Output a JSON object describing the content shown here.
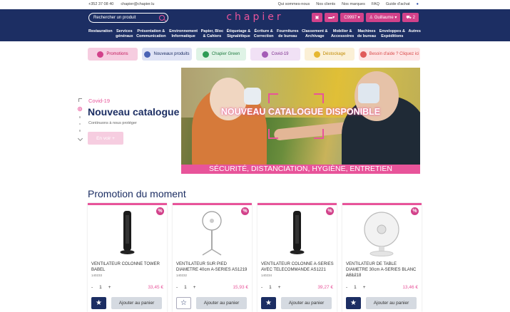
{
  "topbar": {
    "phone": "+352 37 08 40",
    "email": "chapier@chapier.lu",
    "links": [
      "Qui sommes-nous",
      "Nos clients",
      "Nos marques",
      "FAQ",
      "Guide d'achat"
    ]
  },
  "header": {
    "search_placeholder": "Rechercher un produit",
    "logo": "chapier",
    "account_code": "C9997",
    "user": "Guillaume",
    "cart_count": "2"
  },
  "nav": [
    "Restauration",
    "Services\ngénéraux",
    "Présentation &\nCommunication",
    "Environnement\nInformatique",
    "Papier, Bloc\n& Cahiers",
    "Étiquetage &\nSignalétique",
    "Écriture &\nCorrection",
    "Fournitures\nde bureau",
    "Classement &\nArchivage",
    "Mobilier &\nAccessoires",
    "Machines\nde bureau",
    "Enveloppes &\nExpéditions",
    "Autres"
  ],
  "categories": [
    {
      "label": "Promotions",
      "bg": "#f6cde0",
      "color": "#c2185b",
      "icon": "#d2418a"
    },
    {
      "label": "Nouveaux produits",
      "bg": "#dfe3f5",
      "color": "#1c2e63",
      "icon": "#4a63b5"
    },
    {
      "label": "Chapier Green",
      "bg": "#dff3e6",
      "color": "#1c7a3e",
      "icon": "#2e9c55"
    },
    {
      "label": "Covid-19",
      "bg": "#f1e1f5",
      "color": "#7b2c8c",
      "icon": "#a45bb6"
    },
    {
      "label": "Déstockage",
      "bg": "#fbf0d6",
      "color": "#c08a00",
      "icon": "#e6b730"
    },
    {
      "label": "Besoin d'aide ? Cliquez ici",
      "bg": "#fde4e4",
      "color": "#d94a4a",
      "icon": "#e05a5a"
    }
  ],
  "hero": {
    "kicker": "Covid-19",
    "title": "Nouveau catalogue",
    "subtitle": "Continuons à nous protéger",
    "button": "En voir +",
    "banner_title": "NOUVEAU CATALOGUE DISPONIBLE",
    "banner_bottom": "SÉCURITÉ, DISTANCIATION, HYGIÈNE, ENTRETIEN"
  },
  "section_title": "Promotion du moment",
  "products": [
    {
      "name": "VENTILATEUR COLONNE TOWER BABEL",
      "ref": "140233",
      "qty": "1",
      "price": "33,45 €",
      "image": "tower-fan-icon",
      "favorite": true
    },
    {
      "name": "VENTILATEUR SUR PIED DIAMETRE 40cm A-SERIES AS1219",
      "ref": "140232",
      "qty": "1",
      "price": "15,93 €",
      "image": "standing-fan-icon",
      "favorite": false
    },
    {
      "name": "VENTILATEUR COLONNE A-SERIES AVEC TELECOMMANDE AS1221",
      "ref": "140234",
      "qty": "1",
      "price": "39,27 €",
      "image": "tower-fan-icon",
      "favorite": true
    },
    {
      "name": "VENTILATEUR DE TABLE DIAMETRE 30cm A-SERIES BLANC AS1218",
      "ref": "140231",
      "qty": "1",
      "price": "13,46 €",
      "image": "desk-fan-icon",
      "favorite": true
    }
  ],
  "labels": {
    "add_to_cart": "Ajouter au panier",
    "minus": "-",
    "plus": "+",
    "badge": "%"
  }
}
